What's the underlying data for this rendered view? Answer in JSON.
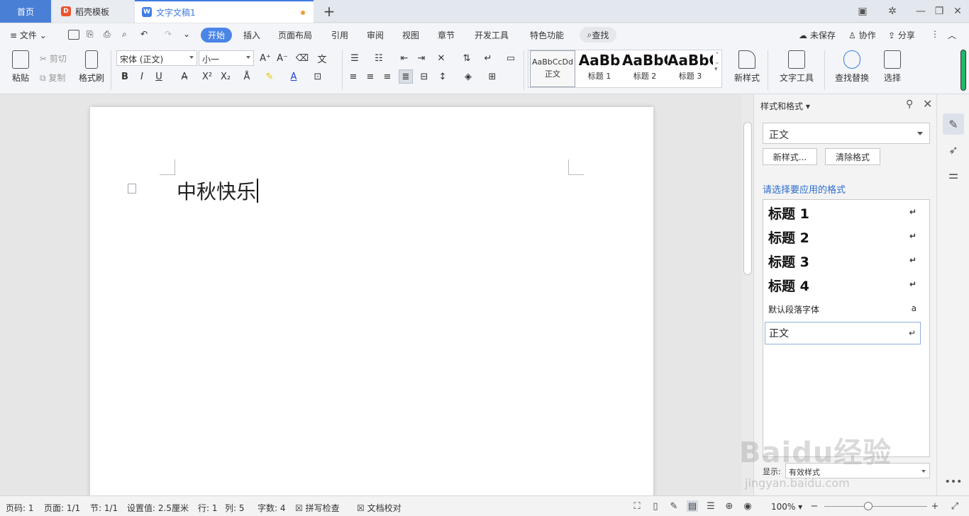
{
  "tabs": {
    "home": "首页",
    "template": "稻壳模板",
    "doc": "文字文稿1",
    "template_icon": "D",
    "doc_icon": "W"
  },
  "menu": {
    "file": "文件",
    "items": [
      "开始",
      "插入",
      "页面布局",
      "引用",
      "审阅",
      "视图",
      "章节",
      "开发工具",
      "特色功能"
    ],
    "search": "查找",
    "unsaved": "未保存",
    "collab": "协作",
    "share": "分享"
  },
  "ribbon": {
    "paste": "粘贴",
    "cut": "剪切",
    "copy": "复制",
    "format_painter": "格式刷",
    "font": "宋体 (正文)",
    "size": "小一",
    "styles": [
      {
        "preview": "AaBbCcDd",
        "label": "正文"
      },
      {
        "preview": "AaBb",
        "label": "标题 1"
      },
      {
        "preview": "AaBbC",
        "label": "标题 2"
      },
      {
        "preview": "AaBbC",
        "label": "标题 3"
      }
    ],
    "new_style": "新样式",
    "text_tools": "文字工具",
    "find_replace": "查找替换",
    "select": "选择"
  },
  "document": {
    "text": "中秋快乐"
  },
  "panel": {
    "title": "样式和格式",
    "current": "正文",
    "new_style": "新样式...",
    "clear_format": "清除格式",
    "choose_label": "请选择要应用的格式",
    "styles": [
      {
        "name": "标题  1",
        "mark": "↵"
      },
      {
        "name": "标题  2",
        "mark": "↵"
      },
      {
        "name": "标题  3",
        "mark": "↵"
      },
      {
        "name": "标题  4",
        "mark": "↵"
      },
      {
        "name": "默认段落字体",
        "mark": "a"
      },
      {
        "name": "正文",
        "mark": "↵"
      }
    ],
    "show_label": "显示:",
    "show_value": "有效样式"
  },
  "status": {
    "page_code": "页码: 1",
    "page": "页面: 1/1",
    "section": "节: 1/1",
    "setting": "设置值: 2.5厘米",
    "row": "行: 1",
    "col": "列: 5",
    "words": "字数: 4",
    "spell": "拼写检查",
    "proof": "文档校对",
    "zoom": "100%",
    "zoom_level": 0.43
  },
  "watermark": {
    "main": "Baidu经验",
    "sub": "jingyan.baidu.com"
  }
}
